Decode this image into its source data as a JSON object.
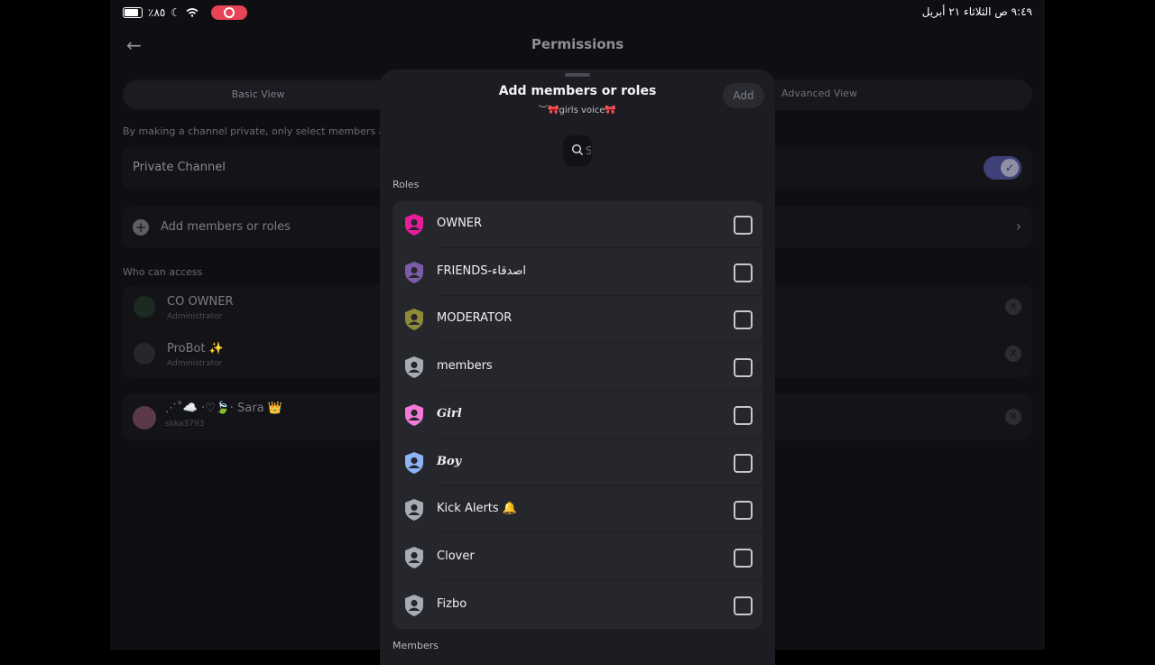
{
  "status_bar": {
    "time_date": "٩:٤٩ ص   الثلاثاء ٢١ أبريل",
    "battery_percent": "٪٨٥"
  },
  "background": {
    "title": "Permissions",
    "tabs": [
      "Basic View",
      "Advanced View"
    ],
    "description": "By making a channel private, only select members and",
    "private_channel_label": "Private Channel",
    "private_channel_enabled": true,
    "add_members_label": "Add members or roles",
    "who_can_access_label": "Who can access",
    "access_list": [
      {
        "name": "CO OWNER",
        "sub": "Administrator"
      },
      {
        "name": "ProBot ✨",
        "sub": "Administrator"
      }
    ],
    "member": {
      "name": "⋰˚☁️ ·♡🍃· Sara 👑",
      "sub": "skka3793"
    }
  },
  "modal": {
    "title": "Add members or roles",
    "subtitle": "︶🎀girls voice🎀",
    "add_button": "Add",
    "search_placeholder": "S",
    "roles_label": "Roles",
    "roles": [
      {
        "name": "OWNER",
        "color": "#e91e9b",
        "italic": false,
        "checked": false
      },
      {
        "name": "FRIENDS-اصدقاء",
        "color": "#7b5ca8",
        "italic": false,
        "checked": false
      },
      {
        "name": "MODERATOR",
        "color": "#8e8a3a",
        "italic": false,
        "checked": false
      },
      {
        "name": "members",
        "color": "#a9abb2",
        "italic": false,
        "checked": false
      },
      {
        "name": "Girl",
        "color": "#f27ad6",
        "italic": true,
        "checked": false
      },
      {
        "name": "Boy",
        "color": "#8fb4f5",
        "italic": true,
        "checked": false
      },
      {
        "name": "Kick Alerts 🔔",
        "color": "#a9abb2",
        "italic": false,
        "checked": false
      },
      {
        "name": "Clover",
        "color": "#a9abb2",
        "italic": false,
        "checked": false
      },
      {
        "name": "Fizbo",
        "color": "#a9abb2",
        "italic": false,
        "checked": false
      }
    ],
    "members_label": "Members"
  }
}
